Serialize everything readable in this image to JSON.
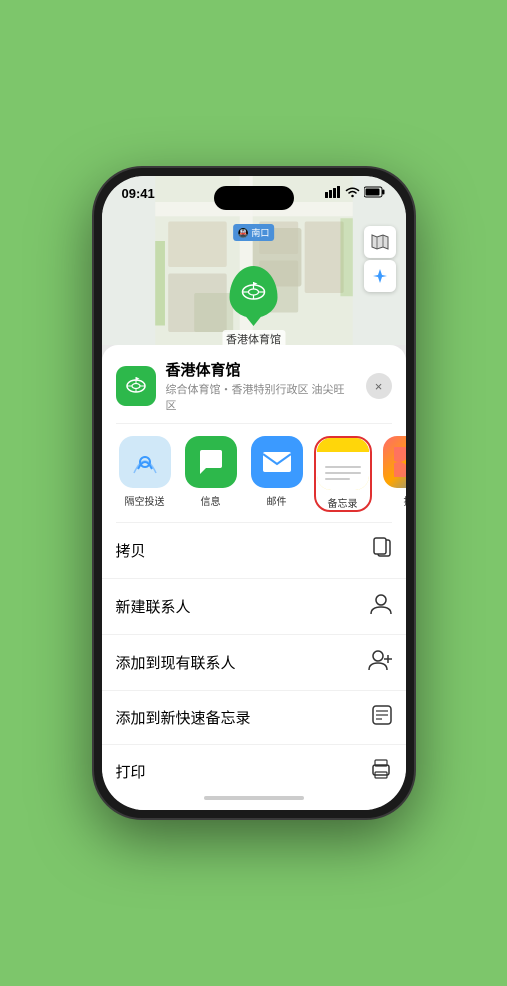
{
  "status_bar": {
    "time": "09:41",
    "location_icon": "▶",
    "signal": "●●●●",
    "wifi": "WiFi",
    "battery": "Battery"
  },
  "map": {
    "subway_label": "🚇 南口",
    "pin_label": "香港体育馆"
  },
  "map_controls": {
    "map_btn_label": "🗺",
    "location_btn_label": "➤"
  },
  "venue": {
    "name": "香港体育馆",
    "description": "综合体育馆・香港特别行政区 油尖旺区",
    "close_label": "×"
  },
  "share_items": [
    {
      "id": "airdrop",
      "label": "隔空投送",
      "type": "airdrop"
    },
    {
      "id": "messages",
      "label": "信息",
      "type": "messages"
    },
    {
      "id": "mail",
      "label": "邮件",
      "type": "mail"
    },
    {
      "id": "notes",
      "label": "备忘录",
      "type": "notes"
    },
    {
      "id": "more",
      "label": "提",
      "type": "more"
    }
  ],
  "actions": [
    {
      "id": "copy",
      "label": "拷贝",
      "icon": "copy"
    },
    {
      "id": "new-contact",
      "label": "新建联系人",
      "icon": "person"
    },
    {
      "id": "add-contact",
      "label": "添加到现有联系人",
      "icon": "person-add"
    },
    {
      "id": "add-notes",
      "label": "添加到新快速备忘录",
      "icon": "memo"
    },
    {
      "id": "print",
      "label": "打印",
      "icon": "print"
    }
  ]
}
